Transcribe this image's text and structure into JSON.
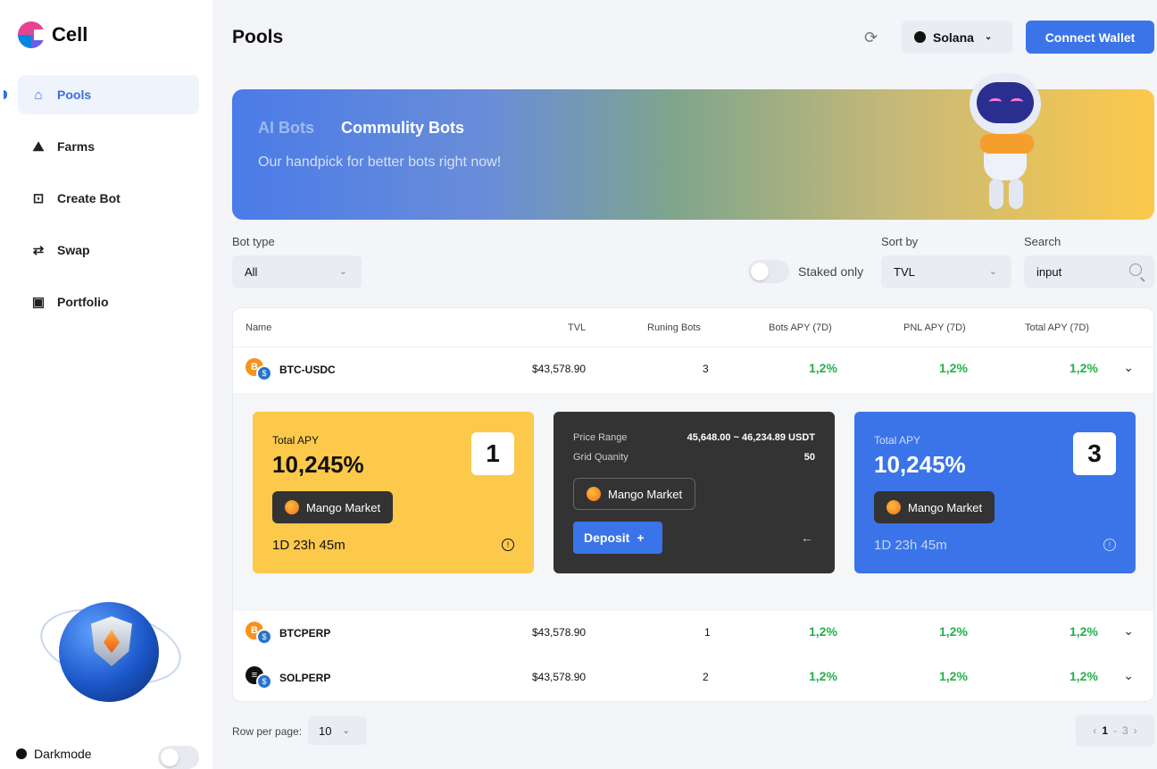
{
  "app": {
    "name": "Cell"
  },
  "sidebar": {
    "items": [
      {
        "label": "Pools",
        "icon": "home-icon",
        "active": true
      },
      {
        "label": "Farms",
        "icon": "farms-icon",
        "active": false
      },
      {
        "label": "Create Bot",
        "icon": "robot-icon",
        "active": false
      },
      {
        "label": "Swap",
        "icon": "swap-icon",
        "active": false
      },
      {
        "label": "Portfolio",
        "icon": "briefcase-icon",
        "active": false
      }
    ],
    "darkmode_label": "Darkmode",
    "darkmode_on": false
  },
  "header": {
    "title": "Pools",
    "network": "Solana",
    "connect_label": "Connect Wallet"
  },
  "banner": {
    "tab_ai": "AI Bots",
    "tab_community": "Commulity Bots",
    "subtitle": "Our handpick for better bots right now!"
  },
  "filters": {
    "bot_type_label": "Bot type",
    "bot_type_value": "All",
    "staked_label": "Staked only",
    "staked_on": false,
    "sort_label": "Sort by",
    "sort_value": "TVL",
    "search_label": "Search",
    "search_value": "input"
  },
  "table": {
    "headers": [
      "Name",
      "TVL",
      "Runing Bots",
      "Bots APY (7D)",
      "PNL APY (7D)",
      "Total APY (7D)"
    ],
    "rows": [
      {
        "name": "BTC-USDC",
        "tvl": "$43,578.90",
        "bots": "3",
        "bots_apy": "1,2%",
        "pnl_apy": "1,2%",
        "total_apy": "1,2%",
        "coin_a": "B",
        "coin_b": "$"
      },
      {
        "name": "BTCPERP",
        "tvl": "$43,578.90",
        "bots": "1",
        "bots_apy": "1,2%",
        "pnl_apy": "1,2%",
        "total_apy": "1,2%",
        "coin_a": "B",
        "coin_b": "$"
      },
      {
        "name": "SOLPERP",
        "tvl": "$43,578.90",
        "bots": "2",
        "bots_apy": "1,2%",
        "pnl_apy": "1,2%",
        "total_apy": "1,2%",
        "coin_a": "≡",
        "coin_b": "$"
      }
    ]
  },
  "cards": {
    "yellow": {
      "label": "Total APY",
      "value": "10,245%",
      "badge": "1",
      "market": "Mango Market",
      "timer": "1D 23h 45m"
    },
    "dark": {
      "price_range_label": "Price Range",
      "price_range_value": "45,648.00 ~ 46,234.89 USDT",
      "grid_label": "Grid Quanity",
      "grid_value": "50",
      "market": "Mango Market",
      "deposit_label": "Deposit",
      "deposit_plus": "+",
      "back": "←"
    },
    "blue": {
      "label": "Total APY",
      "value": "10,245%",
      "badge": "3",
      "market": "Mango Market",
      "timer": "1D 23h 45m"
    }
  },
  "pagination": {
    "rows_label": "Row per page:",
    "rows_value": "10",
    "current": "1",
    "separator": "-",
    "total": "3"
  },
  "colors": {
    "accent": "#3a74e8",
    "positive": "#22b14c",
    "yellow_card": "#fcc94a",
    "dark_card": "#333333"
  }
}
